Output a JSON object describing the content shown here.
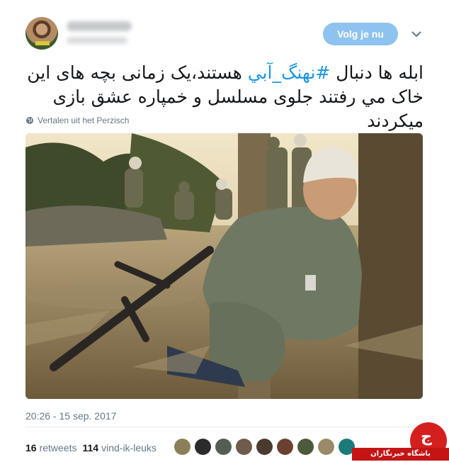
{
  "header": {
    "follow_button": "Volg je nu",
    "menu_icon": "chevron-down-icon"
  },
  "tweet": {
    "text_before_hashtag": "ابله ها دنبال ",
    "hashtag": "#نهنگ_آبي",
    "text_after_hashtag": " هستند،یک زمانی بچه های این خاک مي رفتند جلوی مسلسل و خمپاره عشق بازی میکردند",
    "translate_label": "Vertalen uit het Perzisch",
    "translate_icon": "globe-icon",
    "timestamp": "20:26 - 15 sep. 2017"
  },
  "stats": {
    "retweets_count": "16",
    "retweets_label": "retweets",
    "likes_count": "114",
    "likes_label": "vind-ik-leuks"
  },
  "likers": [
    {
      "color": "#8a7f5a"
    },
    {
      "color": "#2b2b2b"
    },
    {
      "color": "#555e53"
    },
    {
      "color": "#6e5b4c"
    },
    {
      "color": "#4a3a2f"
    },
    {
      "color": "#6b4030"
    },
    {
      "color": "#4b5a3a"
    },
    {
      "color": "#9a8a6a"
    },
    {
      "color": "#1b7a7a"
    }
  ],
  "watermark": {
    "text": "باشگاه خبرنگاران",
    "logo_glyph": "ج"
  },
  "colors": {
    "accent": "#1b95e0",
    "follow_button": "#8dc3ee",
    "brand_red": "#c41414"
  }
}
